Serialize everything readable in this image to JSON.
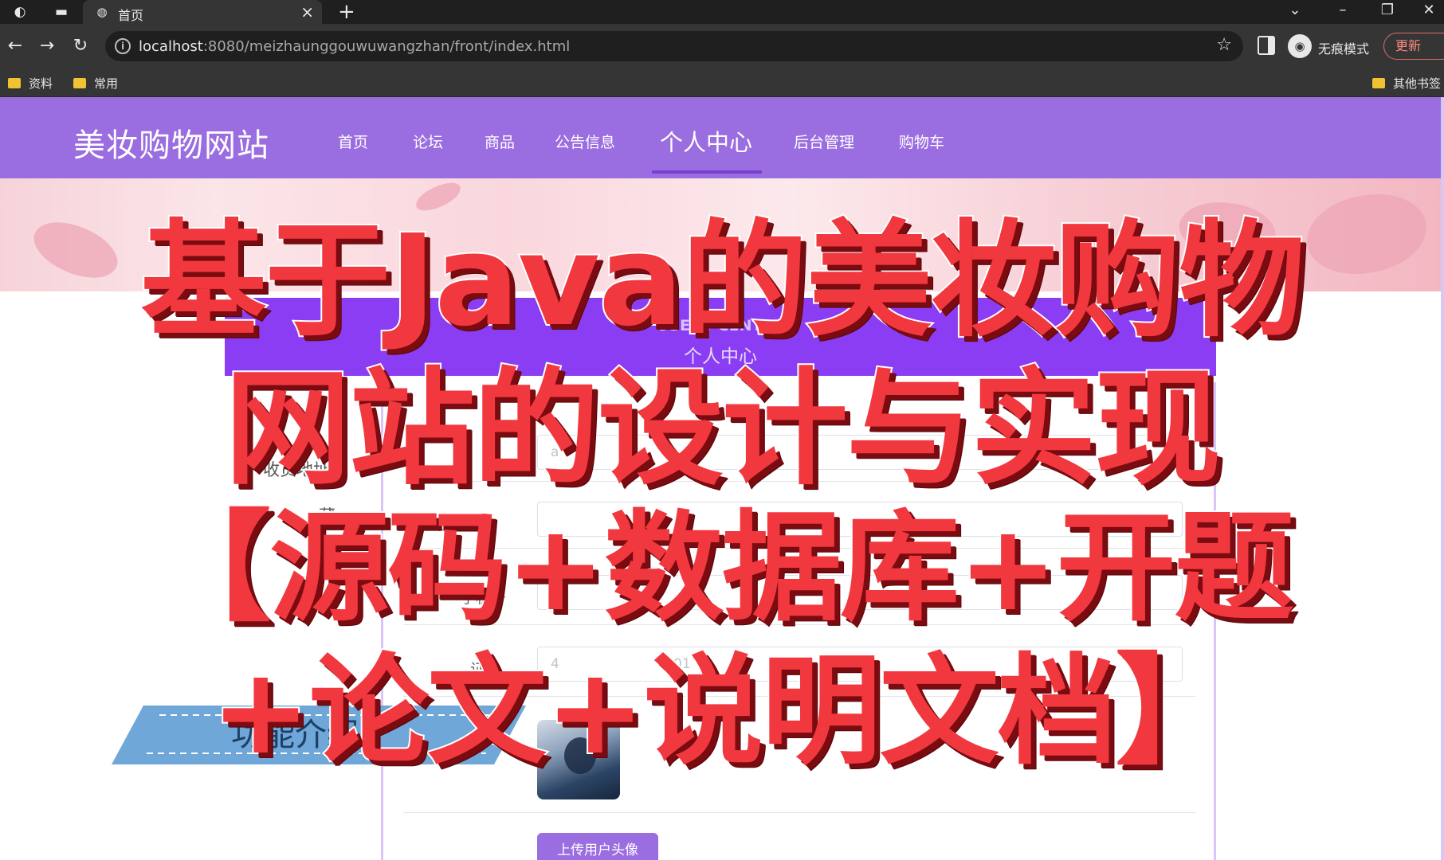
{
  "browser": {
    "tab_title": "首页",
    "url_host": "localhost",
    "url_rest": ":8080/meizhaunggouwuwangzhan/front/index.html",
    "incognito_label": "无痕模式",
    "update_label": "更新",
    "bookmarks": [
      "资料",
      "常用"
    ],
    "other_bookmarks": "其他书签"
  },
  "site": {
    "logo": "美妆购物网站",
    "nav": [
      "首页",
      "论坛",
      "商品",
      "公告信息",
      "个人中心",
      "后台管理",
      "购物车"
    ],
    "active_nav_index": 4
  },
  "page": {
    "center_title_en": "USER / CENTER",
    "center_title_cn": "个人中心",
    "left_menu": [
      "个",
      "收货地址",
      "藏",
      "书"
    ],
    "form_labels": [
      "用户名",
      "手机号",
      "证号"
    ],
    "form_placeholders": [
      "a",
      "",
      "4",
      "01"
    ],
    "upload_label": "上传用户头像"
  },
  "overlay": {
    "lines": [
      "基于Java的美妆购物",
      "网站的设计与实现",
      "【源码+数据库+开题",
      "+论文+说明文档】"
    ],
    "ribbon_text": "功能介绍"
  },
  "colors": {
    "header": "#9a6de0",
    "title_red": "#f2383f",
    "title_shadow": "#7a0b10",
    "center_band": "#8a3df2"
  }
}
